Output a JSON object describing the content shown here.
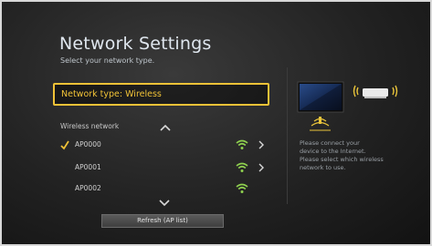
{
  "header": {
    "title": "Network Settings",
    "subtitle": "Select your network type."
  },
  "type_field": {
    "label": "Network type: Wireless"
  },
  "network_list": {
    "label": "Wireless network",
    "items": [
      {
        "name": "AP0000",
        "connected": true,
        "signal": "wifi-icon",
        "arrow": true
      },
      {
        "name": "AP0001",
        "connected": false,
        "signal": "wifi-icon",
        "arrow": true
      },
      {
        "name": "AP0002",
        "connected": false,
        "signal": "wifi-icon",
        "arrow": false
      }
    ]
  },
  "buttons": {
    "refresh": "Refresh (AP list)"
  },
  "help": {
    "text": "Please connect your\ndevice to the Internet.\nPlease select which wireless\nnetwork to use."
  },
  "colors": {
    "accent": "#f0c237",
    "wifi": "#8fd14f",
    "background": "#222222"
  }
}
